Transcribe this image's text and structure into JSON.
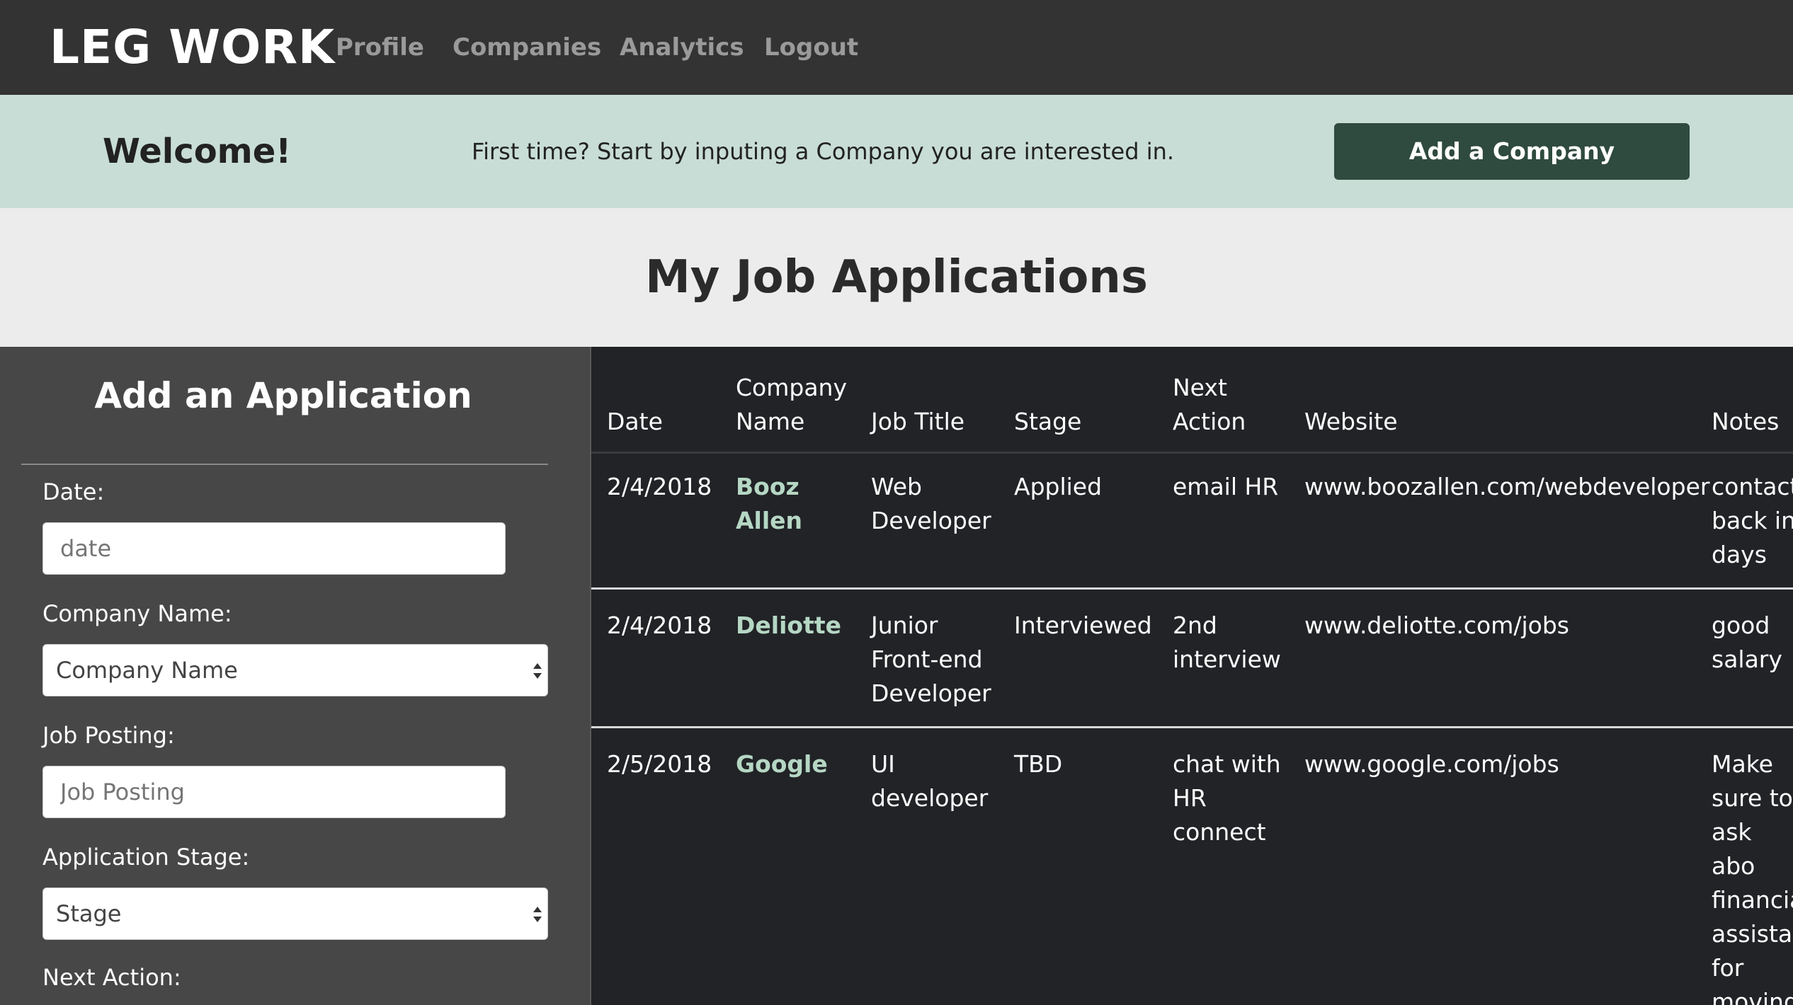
{
  "nav": {
    "brand": "LEG WORK",
    "links": [
      "Profile",
      "Companies",
      "Analytics",
      "Logout"
    ]
  },
  "welcome": {
    "title": "Welcome!",
    "text": "First time? Start by inputing a Company you are interested in.",
    "button": "Add a Company"
  },
  "page_title": "My Job Applications",
  "form": {
    "heading": "Add an Application",
    "date_label": "Date:",
    "date_placeholder": "date",
    "company_label": "Company Name:",
    "company_selected": "Company Name",
    "posting_label": "Job Posting:",
    "posting_placeholder": "Job Posting",
    "stage_label": "Application Stage:",
    "stage_selected": "Stage",
    "next_action_label": "Next Action:"
  },
  "table": {
    "headers": [
      "Date",
      "Company\nName",
      "Job Title",
      "Stage",
      "Next\nAction",
      "Website",
      "Notes"
    ],
    "rows": [
      {
        "date": "2/4/2018",
        "company": "Booz\nAllen",
        "title": "Web\nDeveloper",
        "stage": "Applied",
        "next": "email HR",
        "website": "www.boozallen.com/webdeveloper",
        "notes": "contact\nback in\ndays"
      },
      {
        "date": "2/4/2018",
        "company": "Deliotte",
        "title": "Junior\nFront-end\nDeveloper",
        "stage": "Interviewed",
        "next": "2nd\ninterview",
        "website": "www.deliotte.com/jobs",
        "notes": "good\nsalary"
      },
      {
        "date": "2/5/2018",
        "company": "Google",
        "title": "UI\ndeveloper",
        "stage": "TBD",
        "next": "chat with\nHR\nconnect",
        "website": "www.google.com/jobs",
        "notes": "Make\nsure to\nask abo\nfinancia\nassistar\nfor\nmoving"
      }
    ]
  },
  "colors": {
    "navbar": "#333333",
    "welcome_band": "#c8ddd6",
    "button": "#2f4a3e",
    "form_panel": "#474747",
    "table_panel": "#212326",
    "company_link": "#b5d7c4"
  }
}
